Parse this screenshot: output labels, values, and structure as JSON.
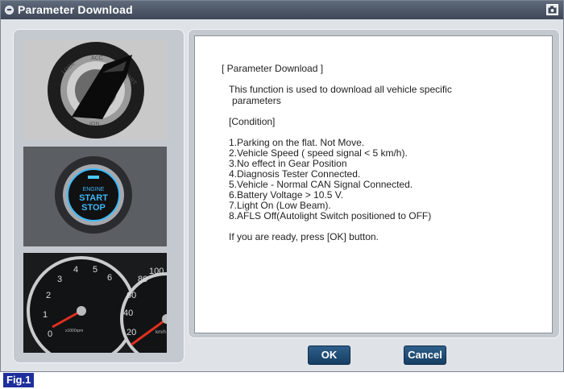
{
  "window": {
    "title": "Parameter Download"
  },
  "left_panel": {
    "photos": [
      {
        "label": "ignition-key-switch",
        "text": [
          "LOCK",
          "ACC",
          "START",
          "IGN"
        ]
      },
      {
        "label": "engine-start-stop-button",
        "text": [
          "ENGINE",
          "START",
          "STOP"
        ]
      },
      {
        "label": "instrument-cluster-gauges",
        "text": [
          "0",
          "1",
          "2",
          "3",
          "4",
          "5",
          "6",
          "x1000rpm",
          "20",
          "40",
          "60",
          "80",
          "100",
          "km/h"
        ]
      }
    ]
  },
  "dialog": {
    "heading": "[ Parameter Download ]",
    "description_line1": "This function is used to download all vehicle specific",
    "description_line2": "parameters",
    "condition_label": "[Condition]",
    "conditions": [
      "1.Parking on the flat. Not Move.",
      "2.Vehicle Speed ( speed signal < 5 km/h).",
      "3.No effect in Gear Position",
      "4.Diagnosis Tester Connected.",
      "5.Vehicle - Normal CAN Signal Connected.",
      "6.Battery Voltage > 10.5 V.",
      "7.Light On (Low Beam).",
      "8.AFLS Off(Autolight Switch positioned to OFF)"
    ],
    "prompt": "If you are ready, press [OK] button."
  },
  "buttons": {
    "ok": "OK",
    "cancel": "Cancel"
  },
  "figure_label": "Fig.1",
  "colors": {
    "titlebar": "#4a5466",
    "button": "#1f4d75",
    "fig_badge": "#1e2f9d"
  }
}
